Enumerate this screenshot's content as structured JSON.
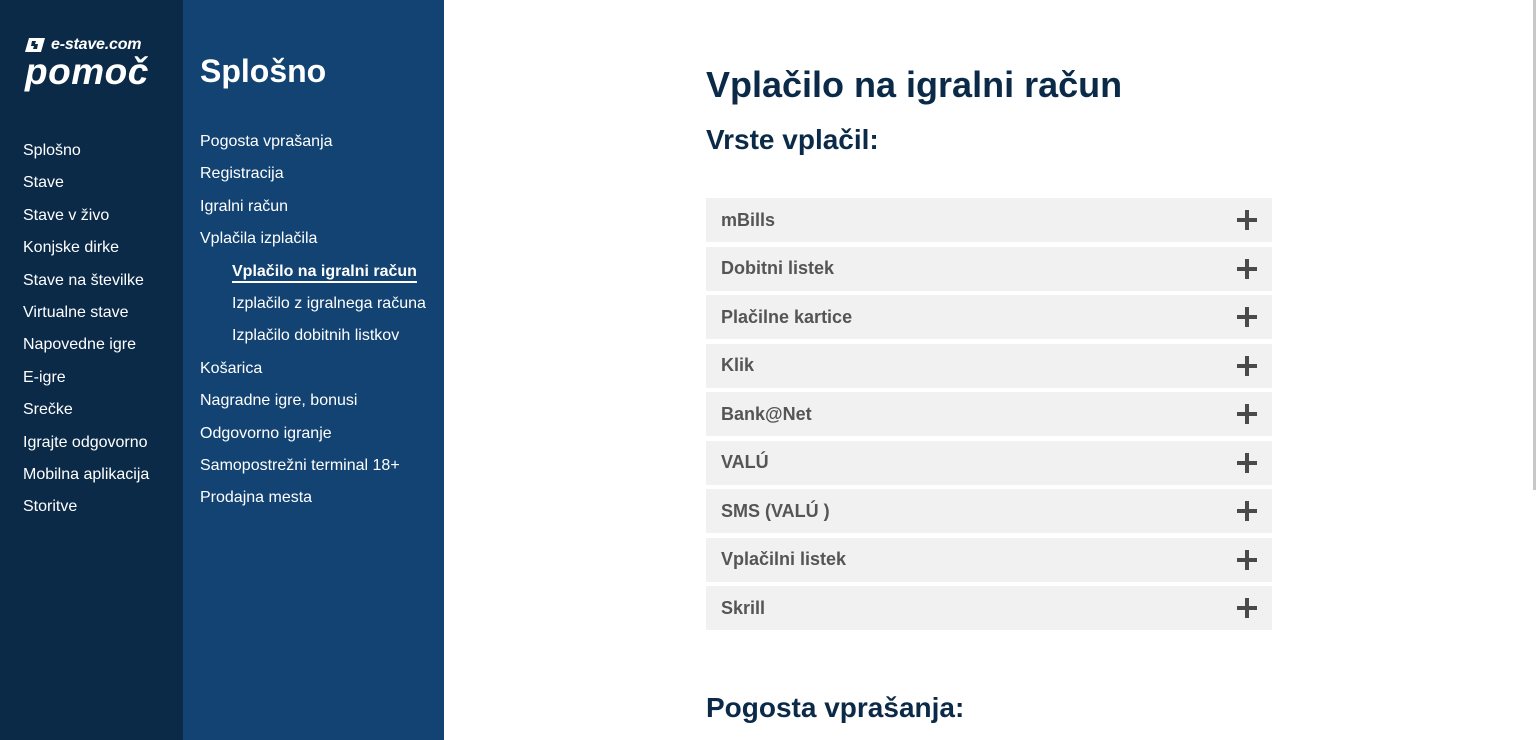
{
  "logo": {
    "brand": "e-stave.com",
    "title": "pomoč"
  },
  "main_menu": [
    "Splošno",
    "Stave",
    "Stave v živo",
    "Konjske dirke",
    "Stave na številke",
    "Virtualne stave",
    "Napovedne igre",
    "E-igre",
    "Srečke",
    "Igrajte odgovorno",
    "Mobilna aplikacija",
    "Storitve"
  ],
  "sub_nav": {
    "title": "Splošno",
    "items": [
      {
        "label": "Pogosta vprašanja"
      },
      {
        "label": "Registracija"
      },
      {
        "label": "Igralni račun"
      },
      {
        "label": "Vplačila izplačila"
      },
      {
        "label": "Vplačilo na igralni račun"
      },
      {
        "label": "Izplačilo z igralnega računa"
      },
      {
        "label": "Izplačilo dobitnih listkov"
      },
      {
        "label": "Košarica"
      },
      {
        "label": "Nagradne igre, bonusi"
      },
      {
        "label": "Odgovorno igranje"
      },
      {
        "label": "Samopostrežni terminal 18+"
      },
      {
        "label": "Prodajna mesta"
      }
    ],
    "active": "Vplačilo na igralni račun"
  },
  "content": {
    "title": "Vplačilo na igralni račun",
    "section_title": "Vrste vplačil:",
    "payment_methods": [
      "mBills",
      "Dobitni listek",
      "Plačilne kartice",
      "Klik",
      "Bank@Net",
      "VALÚ",
      "SMS (VALÚ )",
      "Vplačilni listek",
      "Skrill"
    ],
    "faq_title": "Pogosta vprašanja:"
  },
  "colors": {
    "nav_dark": "#0b2a48",
    "nav_mid": "#134372",
    "accordion_bg": "#f1f1f1",
    "heading": "#0b2a48"
  },
  "icons": {
    "accordion_toggle": "plus-icon",
    "brand_mark": "logo-icon"
  }
}
